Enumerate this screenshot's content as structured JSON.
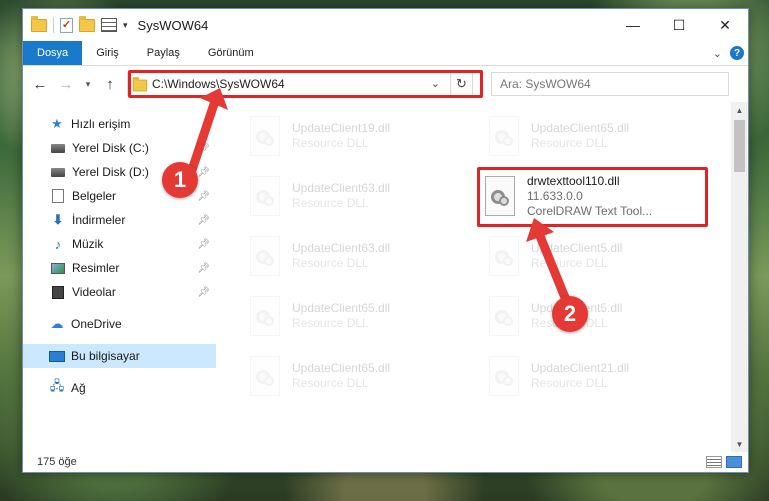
{
  "window": {
    "title": "SysWOW64",
    "controls": {
      "minimize": "—",
      "maximize": "☐",
      "close": "✕"
    }
  },
  "ribbon": {
    "tabs": [
      {
        "label": "Dosya",
        "active": true
      },
      {
        "label": "Giriş"
      },
      {
        "label": "Paylaş"
      },
      {
        "label": "Görünüm"
      }
    ],
    "help": "?"
  },
  "addressbar": {
    "path": "C:\\Windows\\SysWOW64",
    "search_placeholder": "Ara: SysWOW64"
  },
  "sidebar": {
    "items": [
      {
        "label": "Hızlı erişim",
        "icon": "star-icon"
      },
      {
        "label": "Yerel Disk (C:)",
        "icon": "drive-icon",
        "pinned": true
      },
      {
        "label": "Yerel Disk (D:)",
        "icon": "drive-icon",
        "pinned": true
      },
      {
        "label": "Belgeler",
        "icon": "documents-icon",
        "pinned": true
      },
      {
        "label": "İndirmeler",
        "icon": "downloads-icon",
        "pinned": true
      },
      {
        "label": "Müzik",
        "icon": "music-icon",
        "pinned": true
      },
      {
        "label": "Resimler",
        "icon": "pictures-icon",
        "pinned": true
      },
      {
        "label": "Videolar",
        "icon": "videos-icon",
        "pinned": true
      },
      {
        "label": "OneDrive",
        "icon": "cloud-icon"
      },
      {
        "label": "Bu bilgisayar",
        "icon": "computer-icon",
        "selected": true
      },
      {
        "label": "Ağ",
        "icon": "network-icon"
      }
    ]
  },
  "files": [
    {
      "name": "UpdateClient19.dll",
      "type": "Resource DLL"
    },
    {
      "name": "UpdateClient65.dll",
      "type": "Resource DLL"
    },
    {
      "name": "UpdateClient63.dll",
      "type": "Resource DLL"
    },
    {
      "name": "drwtexttool110.dll",
      "version": "11.633.0.0",
      "description": "CorelDRAW Text Tool...",
      "highlighted": true
    },
    {
      "name": "UpdateClient63.dll",
      "type": "Resource DLL"
    },
    {
      "name": "UpdateClient5.dll",
      "type": "Resource DLL"
    },
    {
      "name": "UpdateClient65.dll",
      "type": "Resource DLL"
    },
    {
      "name": "UpdateClient5.dll",
      "type": "Resource DLL"
    },
    {
      "name": "UpdateClient65.dll",
      "type": "Resource DLL"
    },
    {
      "name": "UpdateClient21.dll",
      "type": "Resource DLL"
    }
  ],
  "statusbar": {
    "item_count": "175 öğe"
  },
  "callouts": {
    "one": "1",
    "two": "2"
  },
  "colors": {
    "accent": "#1979ca",
    "highlight": "#e02424",
    "callout": "#e53935",
    "selection": "#cce8ff"
  }
}
